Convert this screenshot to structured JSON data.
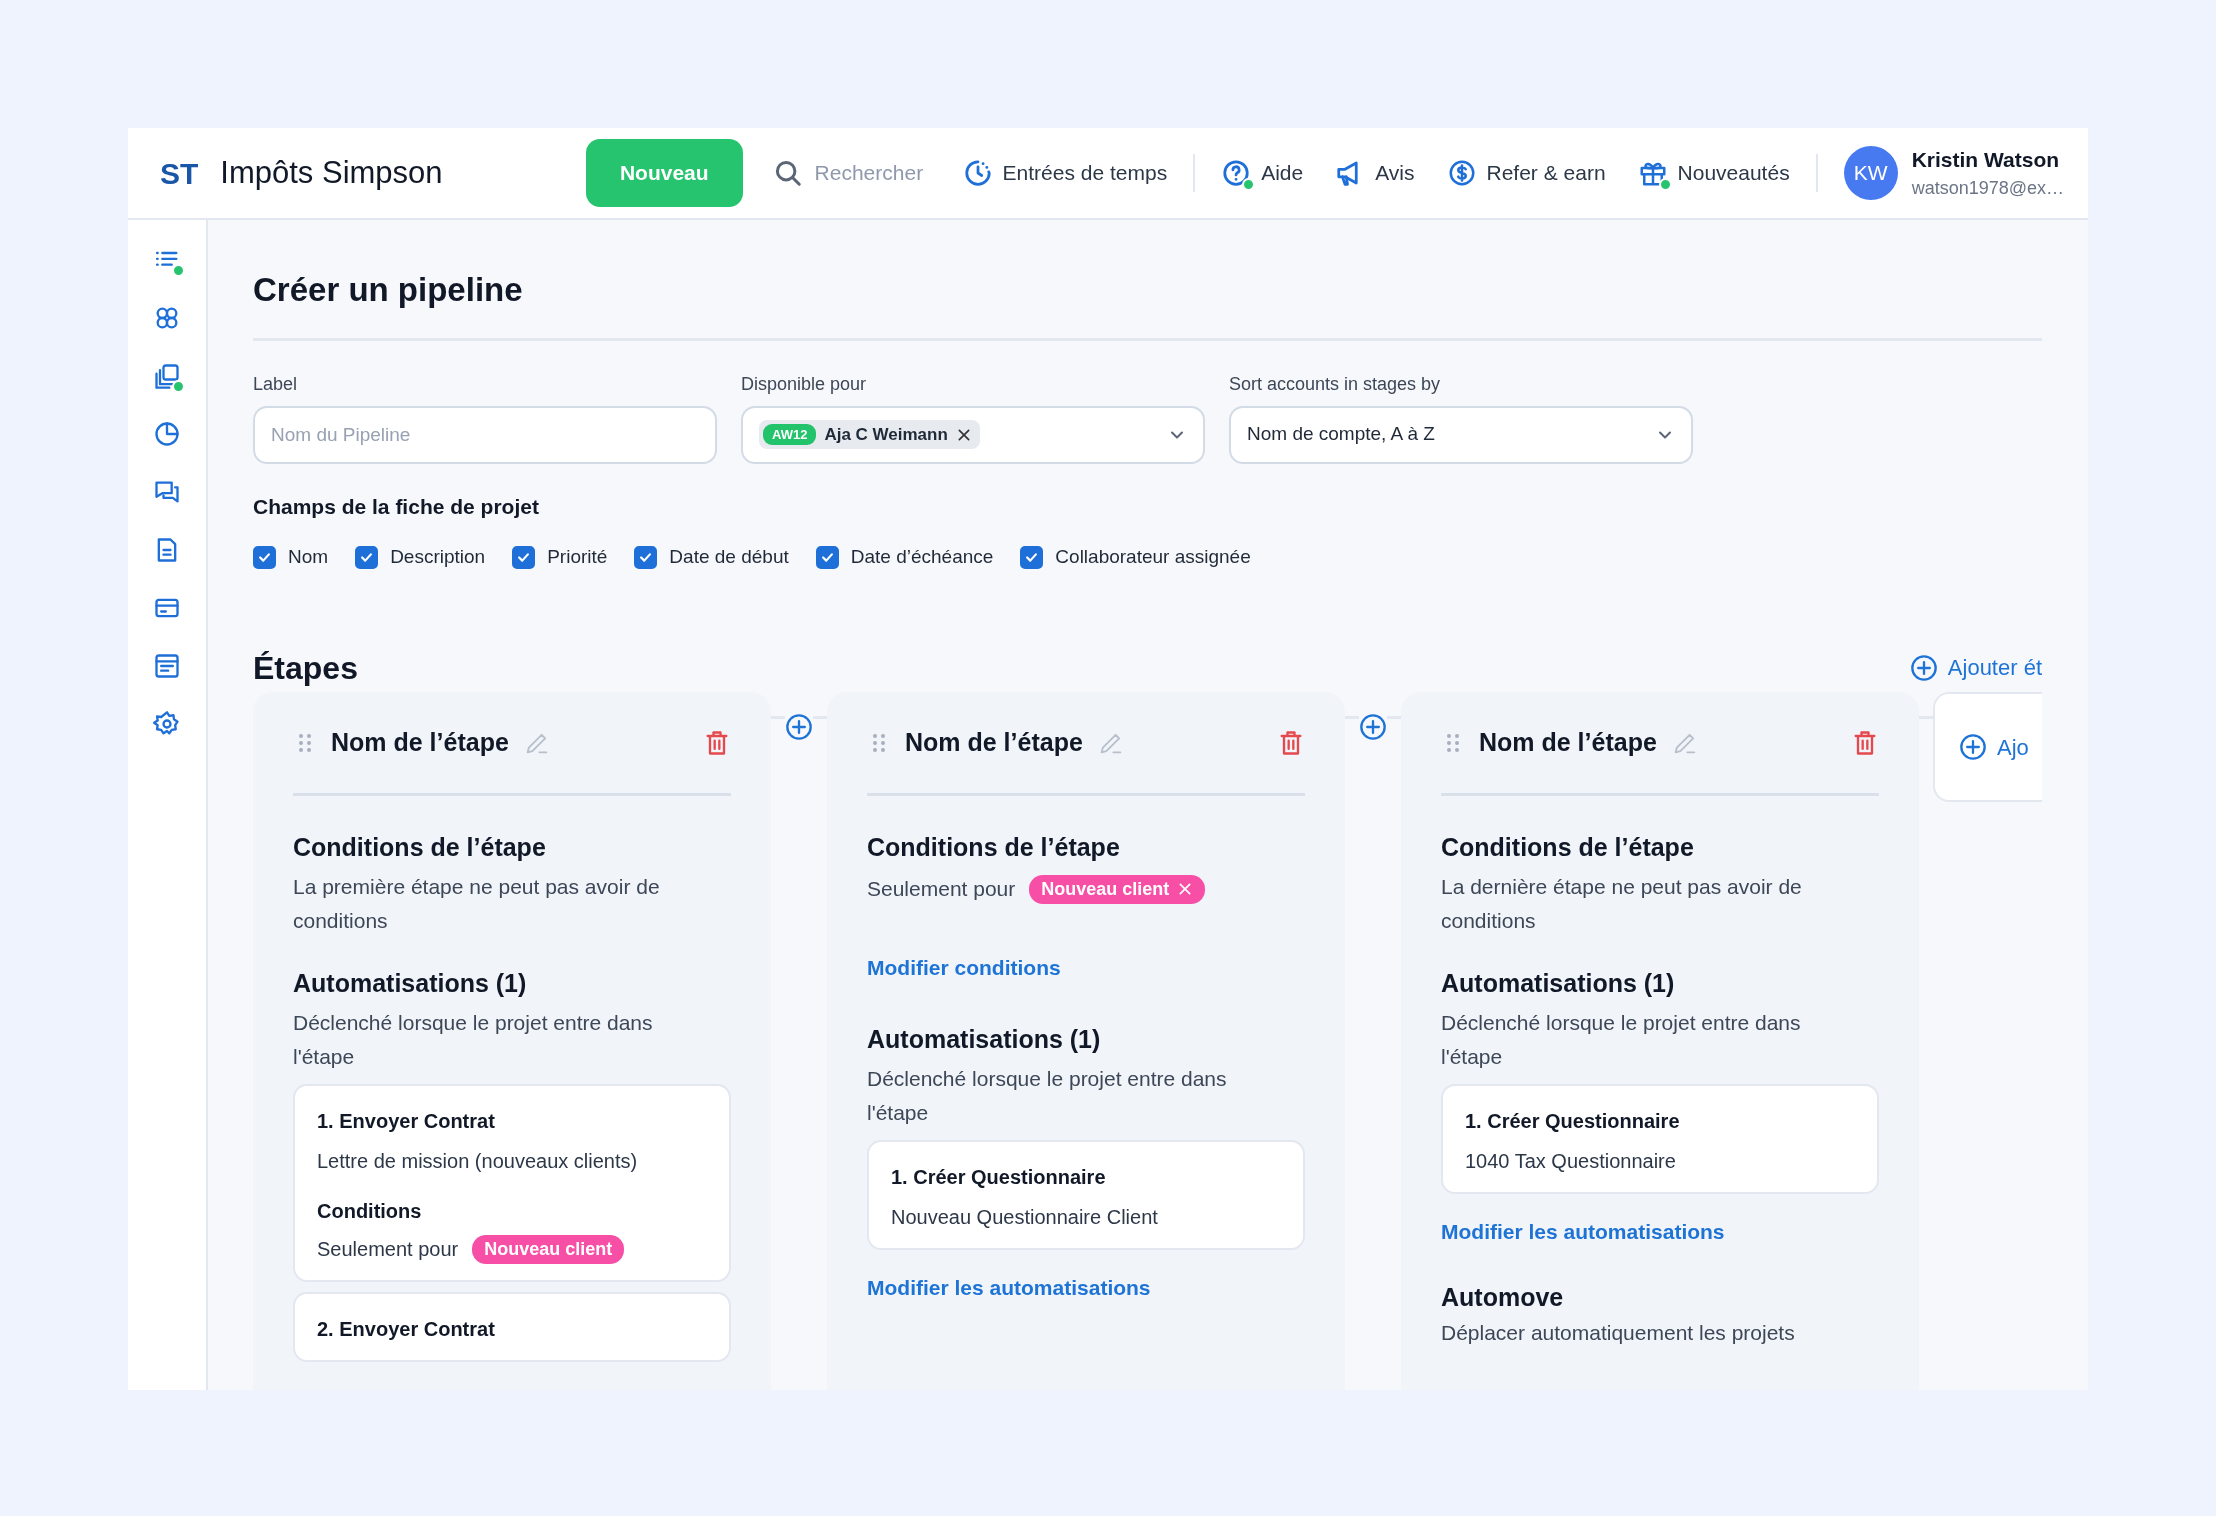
{
  "app": {
    "logo": "ST",
    "name": "Impôts Simpson"
  },
  "header": {
    "new_button": "Nouveau",
    "search": {
      "placeholder": "Rechercher"
    },
    "nav_groups": [
      [
        {
          "kind": "clock",
          "label": "Entrées de temps",
          "notify": false
        }
      ],
      [
        {
          "kind": "help",
          "label": "Aide",
          "notify": true
        },
        {
          "kind": "megaphone",
          "label": "Avis",
          "notify": false
        },
        {
          "kind": "dollar",
          "label": "Refer & earn",
          "notify": false
        },
        {
          "kind": "gift",
          "label": "Nouveautés",
          "notify": true
        }
      ]
    ],
    "user": {
      "initials": "KW",
      "name": "Kristin Watson",
      "email": "watson1978@ex…"
    }
  },
  "sidebar": {
    "items": [
      {
        "kind": "list",
        "notify": true
      },
      {
        "kind": "people",
        "notify": false
      },
      {
        "kind": "copy",
        "notify": true
      },
      {
        "kind": "pie",
        "notify": false
      },
      {
        "kind": "chat",
        "notify": false
      },
      {
        "kind": "document",
        "notify": false
      },
      {
        "kind": "card",
        "notify": false
      },
      {
        "kind": "form",
        "notify": false
      },
      {
        "kind": "gear",
        "notify": false
      }
    ]
  },
  "page_title": "Créer un pipeline",
  "form": {
    "label_field": {
      "label": "Label",
      "placeholder": "Nom du Pipeline"
    },
    "available_for": {
      "label": "Disponible pour",
      "chip": {
        "code": "AW12",
        "name": "Aja C Weimann"
      }
    },
    "sort_by": {
      "label": "Sort accounts in stages by",
      "value": "Nom de compte, A à Z"
    }
  },
  "card_fields": {
    "title": "Champs de la fiche de projet",
    "checkboxes": [
      {
        "label": "Nom",
        "checked": true
      },
      {
        "label": "Description",
        "checked": true
      },
      {
        "label": "Priorité",
        "checked": true
      },
      {
        "label": "Date de début",
        "checked": true
      },
      {
        "label": "Date d’échéance",
        "checked": true
      },
      {
        "label": "Collaborateur assignée",
        "checked": true
      }
    ]
  },
  "stages": {
    "title": "Étapes",
    "add_link": "Ajouter ét",
    "add_card": "Ajo",
    "columns": [
      {
        "name": "Nom de l’étape",
        "conditions": {
          "title": "Conditions de l’étape",
          "text": "La première étape ne peut pas avoir de conditions"
        },
        "automations": {
          "title": "Automatisations (1)",
          "description": "Déclenché lorsque le projet entre dans l'étape",
          "items": [
            {
              "title": "1. Envoyer Contrat",
              "subtitle": "Lettre de mission (nouveaux clients)",
              "conditions": {
                "title": "Conditions",
                "prefix": "Seulement pour",
                "tag": {
                  "label": "Nouveau client",
                  "removable": false
                }
              }
            },
            {
              "title": "2. Envoyer Contrat"
            }
          ]
        }
      },
      {
        "name": "Nom de l’étape",
        "conditions": {
          "title": "Conditions de l’étape",
          "prefix": "Seulement pour",
          "tag": {
            "label": "Nouveau client",
            "removable": true
          }
        },
        "edit_conditions": "Modifier conditions",
        "automations": {
          "title": "Automatisations (1)",
          "description": "Déclenché lorsque le projet entre dans l'étape",
          "items": [
            {
              "title": "1. Créer Questionnaire",
              "subtitle": "Nouveau Questionnaire Client"
            }
          ]
        },
        "edit_automations": "Modifier les automatisations"
      },
      {
        "name": "Nom de l’étape",
        "conditions": {
          "title": "Conditions de l’étape",
          "text": "La dernière étape ne peut pas avoir de conditions"
        },
        "automations": {
          "title": "Automatisations (1)",
          "description": "Déclenché lorsque le projet entre dans l'étape",
          "items": [
            {
              "title": "1. Créer Questionnaire",
              "subtitle": "1040 Tax Questionnaire"
            }
          ]
        },
        "edit_automations": "Modifier les automatisations",
        "automove": {
          "title": "Automove",
          "text": "Déplacer automatiquement les projets"
        }
      }
    ]
  }
}
